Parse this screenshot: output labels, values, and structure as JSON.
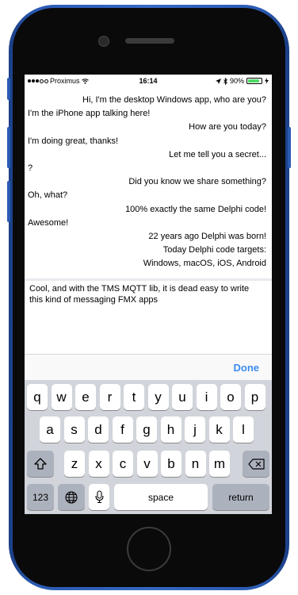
{
  "status_bar": {
    "carrier": "Proximus",
    "time": "16:14",
    "battery": "90%",
    "battery_level": 0.9
  },
  "chat": {
    "messages": [
      {
        "side": "right",
        "text": "Hi, I'm the desktop Windows app, who are you?"
      },
      {
        "side": "left",
        "text": "I'm the iPhone app talking here!"
      },
      {
        "side": "right",
        "text": "How are you today?"
      },
      {
        "side": "left",
        "text": "I'm doing great, thanks!"
      },
      {
        "side": "right",
        "text": "Let me tell you a secret..."
      },
      {
        "side": "left",
        "text": "?"
      },
      {
        "side": "right",
        "text": "Did you know we share something?"
      },
      {
        "side": "left",
        "text": "Oh, what?"
      },
      {
        "side": "right",
        "text": "100% exactly the same Delphi code!"
      },
      {
        "side": "left",
        "text": "Awesome!"
      },
      {
        "side": "right",
        "text": "22 years ago Delphi was born!"
      },
      {
        "side": "right",
        "text": "Today Delphi code targets:"
      },
      {
        "side": "right",
        "text": "Windows, macOS, iOS, Android"
      }
    ]
  },
  "compose": {
    "text": "Cool, and with the TMS MQTT lib, it is dead easy to write this kind of messaging FMX apps"
  },
  "toolbar": {
    "done_label": "Done"
  },
  "keyboard": {
    "row1": [
      "q",
      "w",
      "e",
      "r",
      "t",
      "y",
      "u",
      "i",
      "o",
      "p"
    ],
    "row2": [
      "a",
      "s",
      "d",
      "f",
      "g",
      "h",
      "j",
      "k",
      "l"
    ],
    "row3": [
      "z",
      "x",
      "c",
      "v",
      "b",
      "n",
      "m"
    ],
    "numbers_label": "123",
    "space_label": "space",
    "return_label": "return",
    "globe_icon": "globe-icon",
    "mic_icon": "microphone-icon",
    "shift_icon": "shift-icon",
    "delete_icon": "backspace-icon"
  }
}
